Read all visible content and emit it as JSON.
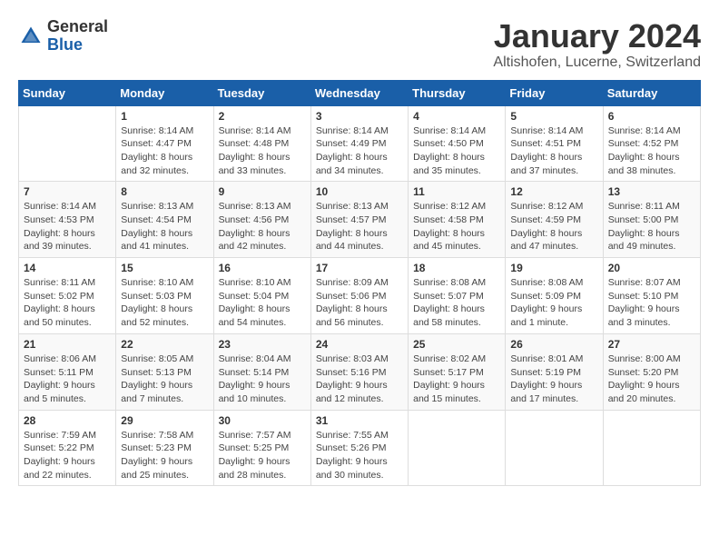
{
  "logo": {
    "general": "General",
    "blue": "Blue"
  },
  "title": "January 2024",
  "subtitle": "Altishofen, Lucerne, Switzerland",
  "days_of_week": [
    "Sunday",
    "Monday",
    "Tuesday",
    "Wednesday",
    "Thursday",
    "Friday",
    "Saturday"
  ],
  "weeks": [
    [
      {
        "day": "",
        "detail": ""
      },
      {
        "day": "1",
        "detail": "Sunrise: 8:14 AM\nSunset: 4:47 PM\nDaylight: 8 hours\nand 32 minutes."
      },
      {
        "day": "2",
        "detail": "Sunrise: 8:14 AM\nSunset: 4:48 PM\nDaylight: 8 hours\nand 33 minutes."
      },
      {
        "day": "3",
        "detail": "Sunrise: 8:14 AM\nSunset: 4:49 PM\nDaylight: 8 hours\nand 34 minutes."
      },
      {
        "day": "4",
        "detail": "Sunrise: 8:14 AM\nSunset: 4:50 PM\nDaylight: 8 hours\nand 35 minutes."
      },
      {
        "day": "5",
        "detail": "Sunrise: 8:14 AM\nSunset: 4:51 PM\nDaylight: 8 hours\nand 37 minutes."
      },
      {
        "day": "6",
        "detail": "Sunrise: 8:14 AM\nSunset: 4:52 PM\nDaylight: 8 hours\nand 38 minutes."
      }
    ],
    [
      {
        "day": "7",
        "detail": "Sunrise: 8:14 AM\nSunset: 4:53 PM\nDaylight: 8 hours\nand 39 minutes."
      },
      {
        "day": "8",
        "detail": "Sunrise: 8:13 AM\nSunset: 4:54 PM\nDaylight: 8 hours\nand 41 minutes."
      },
      {
        "day": "9",
        "detail": "Sunrise: 8:13 AM\nSunset: 4:56 PM\nDaylight: 8 hours\nand 42 minutes."
      },
      {
        "day": "10",
        "detail": "Sunrise: 8:13 AM\nSunset: 4:57 PM\nDaylight: 8 hours\nand 44 minutes."
      },
      {
        "day": "11",
        "detail": "Sunrise: 8:12 AM\nSunset: 4:58 PM\nDaylight: 8 hours\nand 45 minutes."
      },
      {
        "day": "12",
        "detail": "Sunrise: 8:12 AM\nSunset: 4:59 PM\nDaylight: 8 hours\nand 47 minutes."
      },
      {
        "day": "13",
        "detail": "Sunrise: 8:11 AM\nSunset: 5:00 PM\nDaylight: 8 hours\nand 49 minutes."
      }
    ],
    [
      {
        "day": "14",
        "detail": "Sunrise: 8:11 AM\nSunset: 5:02 PM\nDaylight: 8 hours\nand 50 minutes."
      },
      {
        "day": "15",
        "detail": "Sunrise: 8:10 AM\nSunset: 5:03 PM\nDaylight: 8 hours\nand 52 minutes."
      },
      {
        "day": "16",
        "detail": "Sunrise: 8:10 AM\nSunset: 5:04 PM\nDaylight: 8 hours\nand 54 minutes."
      },
      {
        "day": "17",
        "detail": "Sunrise: 8:09 AM\nSunset: 5:06 PM\nDaylight: 8 hours\nand 56 minutes."
      },
      {
        "day": "18",
        "detail": "Sunrise: 8:08 AM\nSunset: 5:07 PM\nDaylight: 8 hours\nand 58 minutes."
      },
      {
        "day": "19",
        "detail": "Sunrise: 8:08 AM\nSunset: 5:09 PM\nDaylight: 9 hours\nand 1 minute."
      },
      {
        "day": "20",
        "detail": "Sunrise: 8:07 AM\nSunset: 5:10 PM\nDaylight: 9 hours\nand 3 minutes."
      }
    ],
    [
      {
        "day": "21",
        "detail": "Sunrise: 8:06 AM\nSunset: 5:11 PM\nDaylight: 9 hours\nand 5 minutes."
      },
      {
        "day": "22",
        "detail": "Sunrise: 8:05 AM\nSunset: 5:13 PM\nDaylight: 9 hours\nand 7 minutes."
      },
      {
        "day": "23",
        "detail": "Sunrise: 8:04 AM\nSunset: 5:14 PM\nDaylight: 9 hours\nand 10 minutes."
      },
      {
        "day": "24",
        "detail": "Sunrise: 8:03 AM\nSunset: 5:16 PM\nDaylight: 9 hours\nand 12 minutes."
      },
      {
        "day": "25",
        "detail": "Sunrise: 8:02 AM\nSunset: 5:17 PM\nDaylight: 9 hours\nand 15 minutes."
      },
      {
        "day": "26",
        "detail": "Sunrise: 8:01 AM\nSunset: 5:19 PM\nDaylight: 9 hours\nand 17 minutes."
      },
      {
        "day": "27",
        "detail": "Sunrise: 8:00 AM\nSunset: 5:20 PM\nDaylight: 9 hours\nand 20 minutes."
      }
    ],
    [
      {
        "day": "28",
        "detail": "Sunrise: 7:59 AM\nSunset: 5:22 PM\nDaylight: 9 hours\nand 22 minutes."
      },
      {
        "day": "29",
        "detail": "Sunrise: 7:58 AM\nSunset: 5:23 PM\nDaylight: 9 hours\nand 25 minutes."
      },
      {
        "day": "30",
        "detail": "Sunrise: 7:57 AM\nSunset: 5:25 PM\nDaylight: 9 hours\nand 28 minutes."
      },
      {
        "day": "31",
        "detail": "Sunrise: 7:55 AM\nSunset: 5:26 PM\nDaylight: 9 hours\nand 30 minutes."
      },
      {
        "day": "",
        "detail": ""
      },
      {
        "day": "",
        "detail": ""
      },
      {
        "day": "",
        "detail": ""
      }
    ]
  ]
}
